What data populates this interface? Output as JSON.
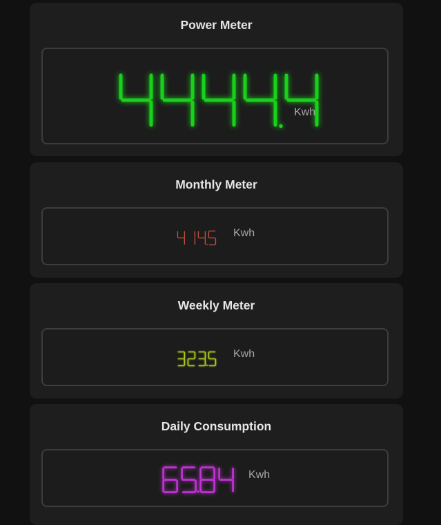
{
  "cards": [
    {
      "title": "Power Meter",
      "value": "4444.4",
      "unit": "Kwh",
      "color": "#19d01b"
    },
    {
      "title": "Monthly Meter",
      "value": "414.5",
      "unit": "Kwh",
      "color": "#c0503a"
    },
    {
      "title": "Weekly Meter",
      "value": "323.5",
      "unit": "Kwh",
      "color": "#b3d21e"
    },
    {
      "title": "Daily Consumption",
      "value": "65.84",
      "unit": "Kwh",
      "color": "#c433d8"
    }
  ]
}
